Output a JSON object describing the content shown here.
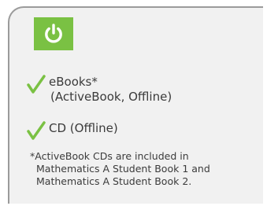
{
  "panel": {
    "accent_color": "#7ac143",
    "power_icon": "power-icon",
    "check_icon": "checkmark-icon"
  },
  "features": {
    "ebooks_line1": "eBooks*",
    "ebooks_line2": "(ActiveBook, Offline)",
    "cd": "CD (Offline)"
  },
  "footnote": {
    "line1": "*ActiveBook CDs are included in",
    "line2": "Mathematics A Student Book 1 and",
    "line3": "Mathematics A Student Book 2."
  }
}
